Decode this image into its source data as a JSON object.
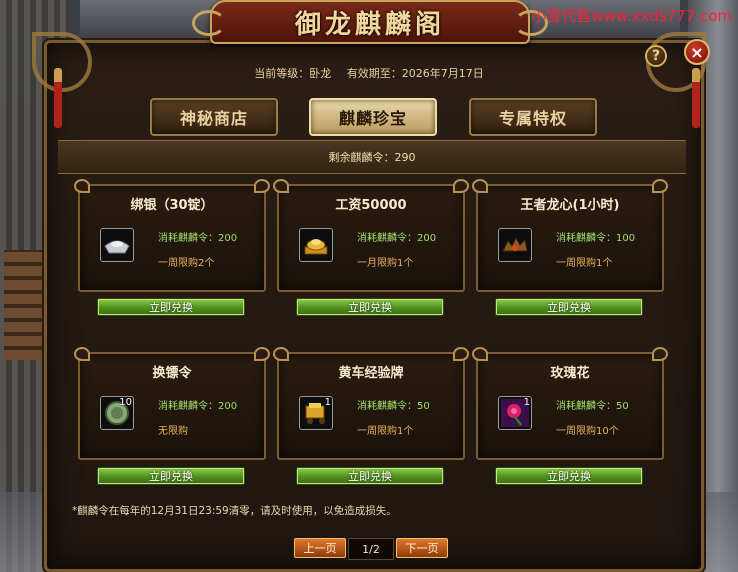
{
  "watermark": "小雪代售www.xxds777.com",
  "title": "御龙麒麟阁",
  "header": {
    "level_label": "当前等级：卧龙",
    "expiry_label": "有效期至：2026年7月17日"
  },
  "tabs": [
    {
      "label": "神秘商店",
      "active": false
    },
    {
      "label": "麒麟珍宝",
      "active": true
    },
    {
      "label": "专属特权",
      "active": false
    }
  ],
  "remaining": "剩余麒麟令：290",
  "items": [
    {
      "name": "绑银（30锭）",
      "cost": "消耗麒麟令：200",
      "limit": "一周限购2个",
      "count": "",
      "icon": "silver-ingot-icon",
      "button": "立即兑换"
    },
    {
      "name": "工资50000",
      "cost": "消耗麒麟令：200",
      "limit": "一月限购1个",
      "count": "",
      "icon": "gold-stack-icon",
      "button": "立即兑换"
    },
    {
      "name": "王者龙心(1小时)",
      "cost": "消耗麒麟令：100",
      "limit": "一周限购1个",
      "count": "",
      "icon": "dragon-heart-icon",
      "button": "立即兑换"
    },
    {
      "name": "换镖令",
      "cost": "消耗麒麟令：200",
      "limit": "无限购",
      "count": "10",
      "icon": "escort-token-icon",
      "button": "立即兑换"
    },
    {
      "name": "黄车经验牌",
      "cost": "消耗麒麟令：50",
      "limit": "一周限购1个",
      "count": "1",
      "icon": "yellow-cart-icon",
      "button": "立即兑换"
    },
    {
      "name": "玫瑰花",
      "cost": "消耗麒麟令：50",
      "limit": "一周限购10个",
      "count": "1",
      "icon": "rose-icon",
      "button": "立即兑换"
    }
  ],
  "footnote": "*麒麟令在每年的12月31日23:59清零，请及时使用，以免造成损失。",
  "pager": {
    "prev": "上一页",
    "page": "1/2",
    "next": "下一页"
  },
  "controls": {
    "help": "?",
    "close": "×"
  }
}
